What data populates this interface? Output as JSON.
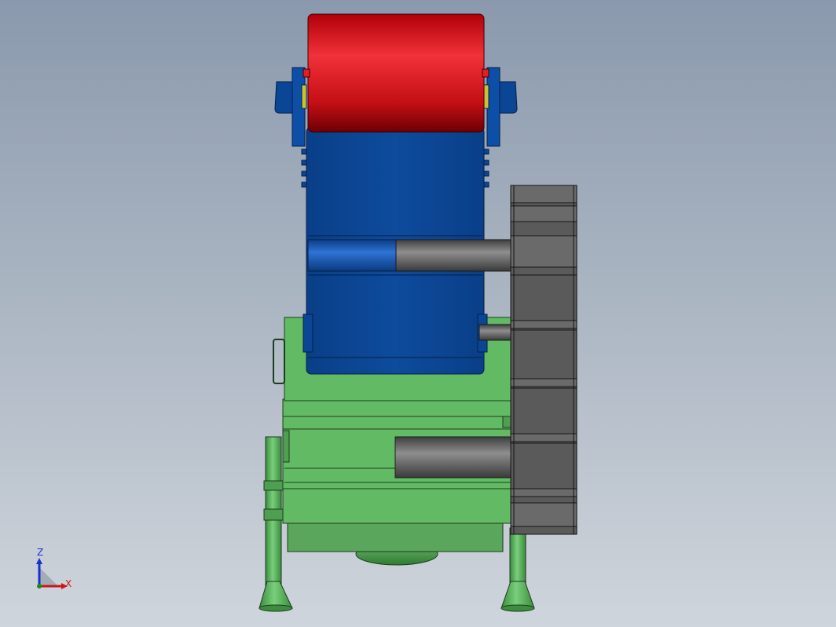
{
  "triad": {
    "z_label": "Z",
    "x_label": "X",
    "colors": {
      "z": "#1a2fd0",
      "x": "#c81818"
    }
  },
  "model": {
    "view": "front",
    "colors": {
      "roller": "#d8161c",
      "body": "#0b4696",
      "base": "#5fbb62",
      "motor": "#5d5d5d",
      "shaft": "#5f5f5f"
    }
  }
}
